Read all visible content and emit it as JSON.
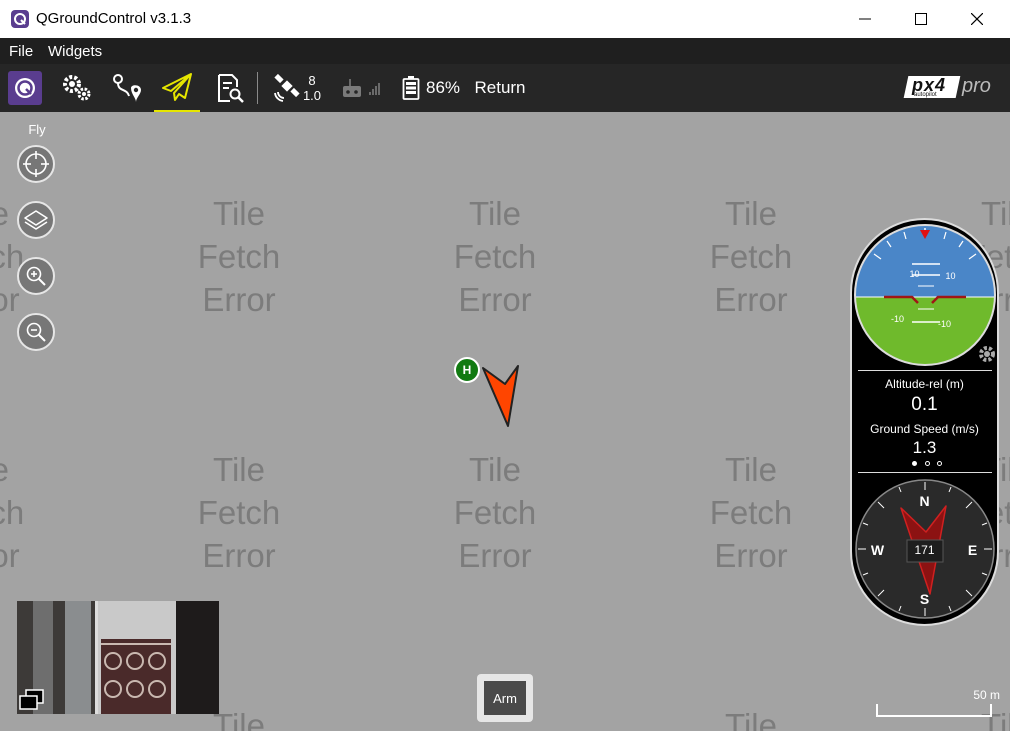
{
  "window": {
    "title": "QGroundControl v3.1.3",
    "minimize": "—",
    "maximize": "☐",
    "close": "✕"
  },
  "menu": {
    "file": "File",
    "widgets": "Widgets"
  },
  "toolbar": {
    "gps_count": "8",
    "gps_hdop": "1.0",
    "battery": "86%",
    "flight_mode": "Return",
    "brand_logo": "px4",
    "brand_sub": "autopilot",
    "brand_pro": "pro"
  },
  "map": {
    "fly_label": "Fly",
    "tile_line1": "Tile",
    "tile_line2": "Fetch",
    "tile_line3": "Error",
    "home_label": "H",
    "scale_label": "50 m"
  },
  "instrument": {
    "pitch_labels": [
      "10",
      "10",
      "-10",
      "-10"
    ],
    "altitude_label": "Altitude-rel (m)",
    "altitude_value": "0.1",
    "ground_speed_label": "Ground Speed (m/s)",
    "ground_speed_value": "1.3",
    "compass_n": "N",
    "compass_s": "S",
    "compass_e": "E",
    "compass_w": "W",
    "heading": "171"
  },
  "arm_button": "Arm",
  "colors": {
    "accent": "#e6e600",
    "vehicle": "#ff4500",
    "home": "#117a11",
    "sky": "#4a86c8",
    "ground": "#6fba2c"
  }
}
